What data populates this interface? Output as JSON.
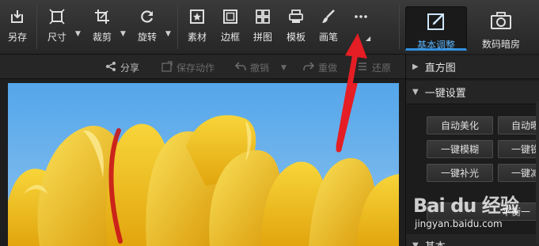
{
  "toolbar": {
    "tools": [
      {
        "label": "另存",
        "icon": "save-as-icon"
      },
      {
        "label": "尺寸",
        "icon": "resize-icon"
      },
      {
        "label": "裁剪",
        "icon": "crop-icon"
      },
      {
        "label": "旋转",
        "icon": "rotate-icon"
      },
      {
        "label": "素材",
        "icon": "star-icon"
      },
      {
        "label": "边框",
        "icon": "frame-icon"
      },
      {
        "label": "拼图",
        "icon": "grid-icon"
      },
      {
        "label": "模板",
        "icon": "template-icon"
      },
      {
        "label": "画笔",
        "icon": "brush-icon"
      },
      {
        "label": "",
        "icon": "more-dots-icon"
      }
    ],
    "modes": [
      {
        "label": "基本调整",
        "icon": "edit-square-icon",
        "active": true
      },
      {
        "label": "数码暗房",
        "icon": "camera-icon",
        "active": false
      }
    ],
    "accent": "#2f8fe0"
  },
  "actions": {
    "share": "分享",
    "save_action": "保存动作",
    "undo": "撤销",
    "redo": "重做",
    "restore": "还原"
  },
  "panel": {
    "histogram": "直方图",
    "one_click": "一键设置",
    "buttons": [
      "自动美化",
      "自动曝",
      "一键模糊",
      "一键锐",
      "一键补光",
      "一键减",
      "平衡一"
    ],
    "basic": "基本"
  },
  "watermark": {
    "logo": "Bai du 经验",
    "url": "jingyan.baidu.com"
  }
}
